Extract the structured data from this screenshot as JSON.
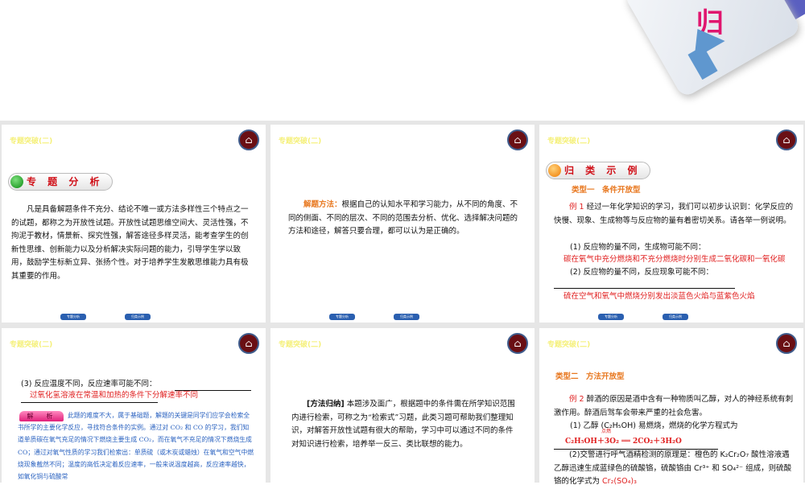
{
  "top_graphic": {
    "label": "归"
  },
  "slide_header": "专题突破(二)",
  "nav_buttons": [
    "专题分析",
    "归类示例"
  ],
  "slides": [
    {
      "badge": "专 题 分 析",
      "body": "凡是具备解题条件不充分、结论不唯一或方法多样性三个特点之一的试题，都称之为开放性试题。开放性试题思维空间大、灵活性强，不拘泥于教材，情景新、探究性强，解答途径多样灵活，能考查学生的创新性思维、创新能力以及分析解决实际问题的能力，引导学生学以致用，鼓励学生标新立异、张扬个性。对于培养学生发散思维能力具有极其重要的作用。"
    },
    {
      "label": "解题方法：",
      "body": "根据自己的认知水平和学习能力，从不同的角度、不同的侧面、不同的层次、不同的范围去分析、优化、选择解决问题的方法和途径，解答只要合理，都可以认为是正确的。"
    },
    {
      "badge": "归 类 示 例",
      "type": "类型一　条件开放型",
      "ex_label": "例 1",
      "ex_body": "经过一年化学知识的学习，我们可以初步认识到：化学反应的快慢、现象、生成物等与反应物的量有着密切关系。请各举一例说明。",
      "q1": "(1) 反应物的量不同，生成物可能不同：",
      "a1": "碳在氧气中充分燃烧和不充分燃烧时分别生成二氧化碳和一氧化碳",
      "q2": "(2) 反应物的量不同，反应现象可能不同：",
      "a2": "硫在空气和氧气中燃烧分别发出淡蓝色火焰与蓝紫色火焰"
    },
    {
      "q3": "(3) 反应温度不同，反应速率可能不同：",
      "a3": "过氧化氢溶液在常温和加热的条件下分解速率不同",
      "analysis_label": "解　析",
      "analysis": "此题的难度不大，属于基础题，解题的关键是同学们应学会检索全书所学的主要化学反应，寻找符合条件的实例。通过对 CO₂ 和 CO 的学习，我们知道单质碳在氧气充足的情况下燃烧主要生成 CO₂，而在氧气不充足的情况下燃烧生成 CO；通过对氧气性质的学习我们检索出：单质硫（或木炭或蜡烛）在氧气和空气中燃烧现象截然不同；温度的高低决定着反应速率，一般来说温度越高，反应速率越快，如氧化铜与硫酸常"
    },
    {
      "label": "[方法归纳]",
      "body": "本题涉及面广，根据题中的条件需在所学知识范围内进行检索，可称之为“检索式”习题，此类习题可帮助我们整理知识，对解答开放性试题有很大的帮助，学习中可以通过不同的条件对知识进行检索，培养举一反三、类比联想的能力。"
    },
    {
      "type": "类型二　方法开放型",
      "ex_label": "例 2",
      "ex_body": "醉酒的原因是酒中含有一种物质叫乙醇，对人的神经系统有刺激作用。醉酒后驾车会带来严重的社会危害。",
      "q1": "(1) 乙醇 (C₂H₅OH) 易燃烧，燃烧的化学方程式为",
      "a1": "C₂H₅OH＋3O₂ ══ 2CO₂＋3H₂O",
      "cond": "点燃",
      "q2": "(2)交警进行呼气酒精检测的原理是：橙色的 K₂Cr₂O₇ 酸性溶液遇乙醇迅速生成蓝绿色的硫酸铬，硫酸铬由 Cr³⁺ 和 SO₄²⁻ 组成，则硫酸铬的化学式为",
      "a2": "Cr₂(SO₄)₃"
    }
  ],
  "colors": {
    "title": "#f5f07a",
    "red": "#e02020",
    "orange": "#e87820",
    "blue": "#2a62c0"
  }
}
